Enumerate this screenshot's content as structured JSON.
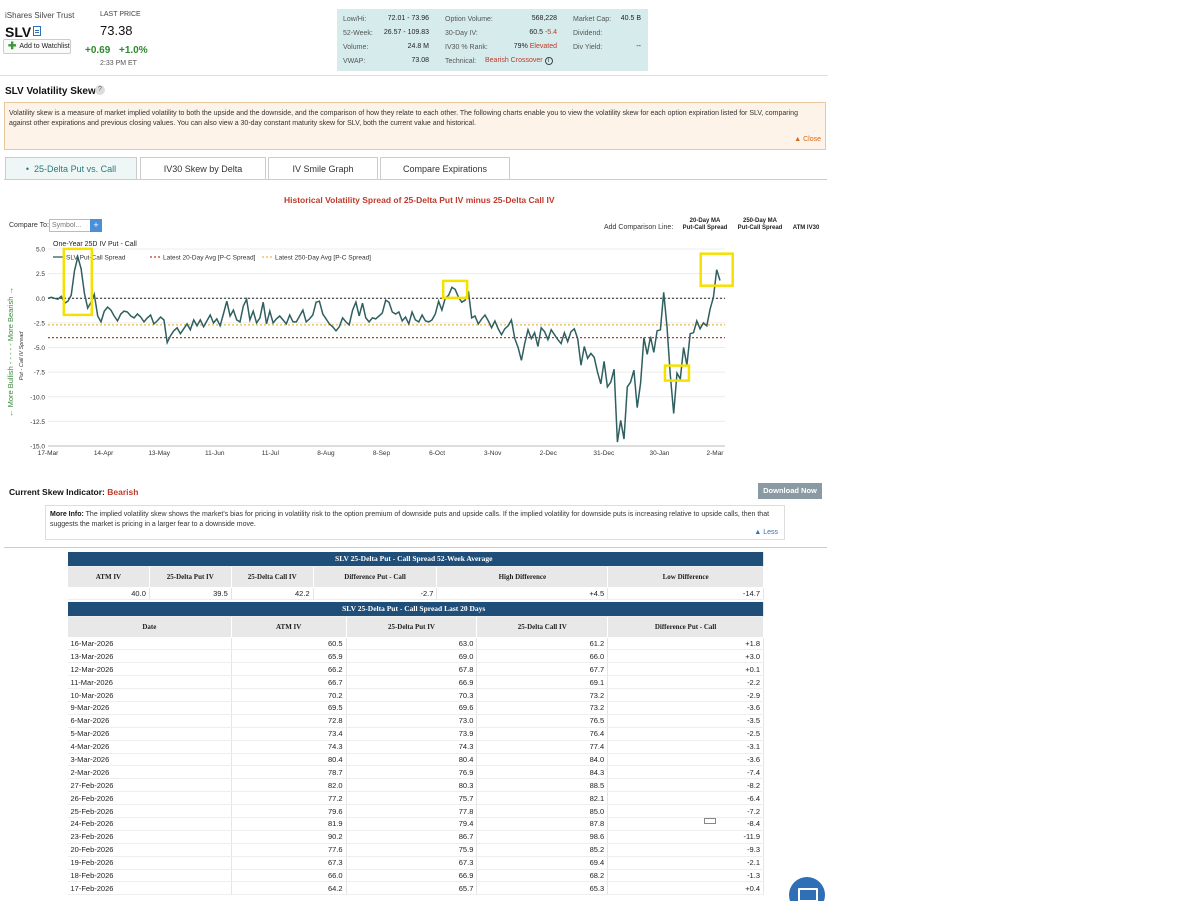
{
  "header": {
    "fund_name": "iShares Silver Trust",
    "ticker": "SLV",
    "watchlist_label": "Add to Watchlist",
    "last_price_label": "LAST PRICE",
    "last_price": "73.38",
    "change": "+0.69",
    "change_pct": "+1.0%",
    "time": "2:33 PM ET"
  },
  "stats": {
    "low_high_label": "Low/Hi:",
    "low_high": "72.01 - 73.96",
    "week52_label": "52-Week:",
    "week52": "26.57 - 109.83",
    "volume_label": "Volume:",
    "volume": "24.8 M",
    "vwap_label": "VWAP:",
    "vwap": "73.08",
    "opt_vol_label": "Option Volume:",
    "opt_vol": "568,228",
    "iv30_label": "30-Day IV:",
    "iv30": "60.5",
    "iv30_chg": "-5.4",
    "ivrank_label": "IV30 % Rank:",
    "ivrank": "79%",
    "ivrank_status": "Elevated",
    "technical_label": "Technical:",
    "technical": "Bearish Crossover",
    "mktcap_label": "Market Cap:",
    "mktcap": "40.5 B",
    "dividend_label": "Dividend:",
    "dividend": "",
    "divyield_label": "Div Yield:",
    "divyield": "--"
  },
  "section": {
    "title": "SLV Volatility Skew",
    "help": "?",
    "description": "Volatility skew is a measure of market implied volatility to both the upside and the downside, and the comparison of how they relate to each other. The following charts enable you to view the volatility skew for each option expiration listed for SLV, comparing against other expirations and previous closing values. You can also view a 30-day constant maturity skew for SLV, both the current value and historical.",
    "close": "▲ Close"
  },
  "tabs": [
    {
      "label": "25-Delta Put vs. Call",
      "bullet": "•"
    },
    {
      "label": "IV30 Skew by Delta"
    },
    {
      "label": "IV Smile Graph"
    },
    {
      "label": "Compare Expirations"
    }
  ],
  "chart_controls": {
    "title": "Historical Volatility Spread of 25-Delta Put IV minus 25-Delta Call IV",
    "compare_to": "Compare To:",
    "symbol_placeholder": "Symbol...",
    "plus": "+",
    "add_comparison": "Add Comparison Line:",
    "opt20": "20-Day MA Put-Call Spread",
    "opt20a": "20-Day MA",
    "opt20b": "Put-Call Spread",
    "opt250a": "250-Day MA",
    "opt250b": "Put-Call Spread",
    "optatm": "ATM IV30"
  },
  "chart_data": {
    "type": "line",
    "subtitle": "One-Year 25D IV Put - Call",
    "ylabel": "Put - Call IV Spread",
    "side_label_bull": "← More Bullish - - - - - More Bearish →",
    "ylim": [
      -15,
      5
    ],
    "yticks": [
      "5.0",
      "2.5",
      "0.0",
      "-2.5",
      "-5.0",
      "-7.5",
      "-10.0",
      "-12.5",
      "-15.0"
    ],
    "xticks": [
      "17-Mar",
      "14-Apr",
      "13-May",
      "11-Jun",
      "11-Jul",
      "8-Aug",
      "8-Sep",
      "6-Oct",
      "3-Nov",
      "2-Dec",
      "31-Dec",
      "30-Jan",
      "2-Mar"
    ],
    "legend": [
      "SLV Put-Call Spread",
      "Latest 20-Day Avg [P-C Spread]",
      "Latest 250-Day Avg [P-C Spread]"
    ],
    "series_color": "#2f5f5f",
    "avg20_value": -4.0,
    "avg250_value": -2.7,
    "avg20_color": "#c0392b",
    "avg250_color": "#e8b84a",
    "series": [
      0.0,
      0.1,
      0.0,
      -0.1,
      0.2,
      -0.5,
      -0.3,
      0.3,
      2.8,
      4.2,
      3.0,
      0.5,
      -1.0,
      -0.4,
      0.4,
      -1.8,
      -2.4,
      -1.3,
      -0.9,
      -1.2,
      -1.8,
      -2.3,
      -1.6,
      -1.3,
      -1.4,
      -1.8,
      -2.0,
      -1.6,
      -1.9,
      -2.4,
      -2.0,
      -1.7,
      -2.6,
      -2.3,
      -1.9,
      -2.2,
      -4.5,
      -3.8,
      -3.3,
      -3.0,
      -3.6,
      -3.1,
      -2.6,
      -3.2,
      -2.2,
      -2.8,
      -2.2,
      -2.9,
      -2.3,
      -1.7,
      -2.5,
      -2.1,
      -2.8,
      -1.6,
      -0.3,
      -1.8,
      -1.2,
      -2.2,
      -2.4,
      -0.8,
      -0.1,
      -2.2,
      -1.3,
      -2.5,
      -2.0,
      -0.4,
      -2.6,
      -1.3,
      -2.5,
      -2.1,
      -1.8,
      -2.2,
      -2.6,
      -1.7,
      -2.4,
      -2.4,
      -1.8,
      -1.2,
      -2.4,
      -2.1,
      -1.7,
      -0.4,
      -0.3,
      -1.6,
      -2.1,
      -2.6,
      -2.9,
      -3.3,
      -2.9,
      -2.0,
      -2.4,
      -2.7,
      -1.2,
      -0.4,
      -1.8,
      -0.5,
      -2.0,
      -2.4,
      -2.0,
      -2.1,
      -1.8,
      -1.5,
      -0.2,
      -0.4,
      -1.4,
      -1.6,
      -1.4,
      -2.3,
      -1.9,
      -2.6,
      -1.4,
      -2.2,
      -2.4,
      -1.7,
      -2.3,
      -2.4,
      -2.2,
      -1.6,
      -0.3,
      -1.2,
      0.0,
      0.3,
      1.1,
      0.9,
      0.1,
      -0.4,
      -0.2,
      0.7,
      -2.0,
      -1.8,
      -2.6,
      -2.1,
      -1.7,
      -2.3,
      -3.0,
      -2.3,
      -3.1,
      -3.7,
      -3.1,
      -2.8,
      -2.2,
      -4.1,
      -5.0,
      -6.3,
      -4.6,
      -3.2,
      -4.1,
      -3.5,
      -4.9,
      -3.0,
      -3.4,
      -4.2,
      -3.2,
      -3.7,
      -4.2,
      -4.6,
      -3.5,
      -4.4,
      -3.4,
      -3.1,
      -4.1,
      -6.8,
      -4.9,
      -6.1,
      -5.6,
      -6.0,
      -7.5,
      -8.7,
      -6.4,
      -9.0,
      -8.5,
      -7.2,
      -14.6,
      -12.4,
      -14.3,
      -9.0,
      -8.5,
      -7.3,
      -11.1,
      -8.6,
      -4.0,
      -5.7,
      -3.9,
      -5.5,
      -3.3,
      -3.2,
      0.6,
      -2.9,
      -7.8,
      -11.7,
      -7.6,
      -8.2,
      -5.0,
      -6.8,
      -3.6,
      -3.5,
      -2.3,
      -3.1,
      -2.5,
      -2.8,
      -1.1,
      0.1,
      2.9,
      1.8
    ]
  },
  "skew": {
    "label": "Current Skew Indicator:",
    "value": "Bearish",
    "download": "Download Now"
  },
  "more_info": {
    "label": "More Info:",
    "text": "The implied volatility skew shows the market's bias for pricing in volatility risk to the option premium of downside puts and upside calls. If the implied volatility for downside puts is increasing relative to upside calls, then that suggests the market is pricing in a larger fear to a downside move.",
    "less": "▲ Less"
  },
  "avg_table": {
    "caption": "SLV 25-Delta Put - Call Spread 52-Week Average",
    "headers": [
      "ATM IV",
      "25-Delta Put IV",
      "25-Delta Call IV",
      "Difference Put - Call",
      "High Difference",
      "Low Difference"
    ],
    "row": [
      "40.0",
      "39.5",
      "42.2",
      "-2.7",
      "+4.5",
      "-14.7"
    ]
  },
  "days_table": {
    "caption": "SLV 25-Delta Put - Call Spread Last 20 Days",
    "headers": [
      "Date",
      "ATM IV",
      "25-Delta Put IV",
      "25-Delta Call IV",
      "Difference Put - Call"
    ],
    "rows": [
      [
        "16-Mar-2026",
        "60.5",
        "63.0",
        "61.2",
        "+1.8"
      ],
      [
        "13-Mar-2026",
        "65.9",
        "69.0",
        "66.0",
        "+3.0"
      ],
      [
        "12-Mar-2026",
        "66.2",
        "67.8",
        "67.7",
        "+0.1"
      ],
      [
        "11-Mar-2026",
        "66.7",
        "66.9",
        "69.1",
        "-2.2"
      ],
      [
        "10-Mar-2026",
        "70.2",
        "70.3",
        "73.2",
        "-2.9"
      ],
      [
        "9-Mar-2026",
        "69.5",
        "69.6",
        "73.2",
        "-3.6"
      ],
      [
        "6-Mar-2026",
        "72.8",
        "73.0",
        "76.5",
        "-3.5"
      ],
      [
        "5-Mar-2026",
        "73.4",
        "73.9",
        "76.4",
        "-2.5"
      ],
      [
        "4-Mar-2026",
        "74.3",
        "74.3",
        "77.4",
        "-3.1"
      ],
      [
        "3-Mar-2026",
        "80.4",
        "80.4",
        "84.0",
        "-3.6"
      ],
      [
        "2-Mar-2026",
        "78.7",
        "76.9",
        "84.3",
        "-7.4"
      ],
      [
        "27-Feb-2026",
        "82.0",
        "80.3",
        "88.5",
        "-8.2"
      ],
      [
        "26-Feb-2026",
        "77.2",
        "75.7",
        "82.1",
        "-6.4"
      ],
      [
        "25-Feb-2026",
        "79.6",
        "77.8",
        "85.0",
        "-7.2"
      ],
      [
        "24-Feb-2026",
        "81.9",
        "79.4",
        "87.8",
        "-8.4"
      ],
      [
        "23-Feb-2026",
        "90.2",
        "86.7",
        "98.6",
        "-11.9"
      ],
      [
        "20-Feb-2026",
        "77.6",
        "75.9",
        "85.2",
        "-9.3"
      ],
      [
        "19-Feb-2026",
        "67.3",
        "67.3",
        "69.4",
        "-2.1"
      ],
      [
        "18-Feb-2026",
        "66.0",
        "66.9",
        "68.2",
        "-1.3"
      ],
      [
        "17-Feb-2026",
        "64.2",
        "65.7",
        "65.3",
        "+0.4"
      ]
    ]
  },
  "colors": {
    "accent": "#2a7a7a",
    "table_caption_bg": "#1f4e79",
    "highlight": "#f5e100"
  }
}
